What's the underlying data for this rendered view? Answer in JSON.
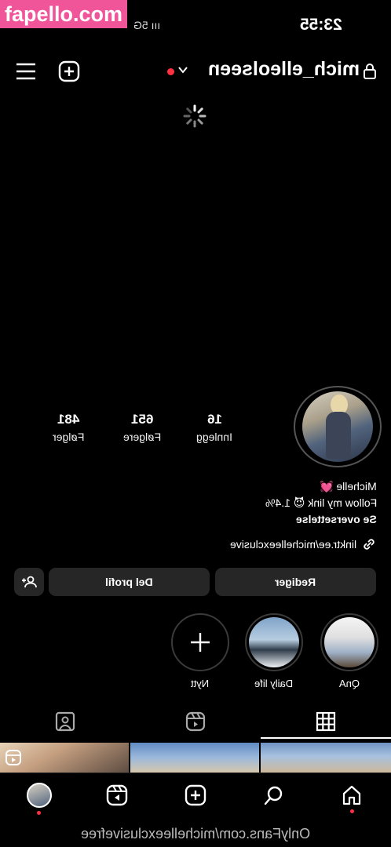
{
  "watermark": "fapello.com",
  "status": {
    "time": "23:55",
    "signal": "ııı 5G"
  },
  "header": {
    "username": "mich_elleolseen"
  },
  "profile": {
    "stats": [
      {
        "value": "16",
        "label": "Innlegg"
      },
      {
        "value": "651",
        "label": "Følgere"
      },
      {
        "value": "481",
        "label": "Følger"
      }
    ],
    "name": "Michelle 💓",
    "bio": "Follow my link 😈 1.4%",
    "translate": "Se oversettelse",
    "link": "linktr.ee/michelleexclusive"
  },
  "actions": {
    "edit": "Rediger",
    "share": "Del profil"
  },
  "highlights": [
    {
      "label": "QnA"
    },
    {
      "label": "Daily life"
    },
    {
      "label": "Nytt"
    }
  ],
  "tabs": {
    "active": "grid"
  },
  "footer": "OnlyFans.com/michelleexclusivefree",
  "colors": {
    "accent": "#ff3040",
    "watermark": "#f0559a",
    "button": "#262626"
  },
  "icons": [
    "lock-icon",
    "chevron-down-icon",
    "menu-icon",
    "add-post-icon",
    "loading-spinner-icon",
    "link-icon",
    "add-person-icon",
    "plus-icon",
    "grid-icon",
    "reels-icon",
    "tagged-icon",
    "home-icon",
    "search-icon",
    "create-icon",
    "reels-nav-icon"
  ]
}
